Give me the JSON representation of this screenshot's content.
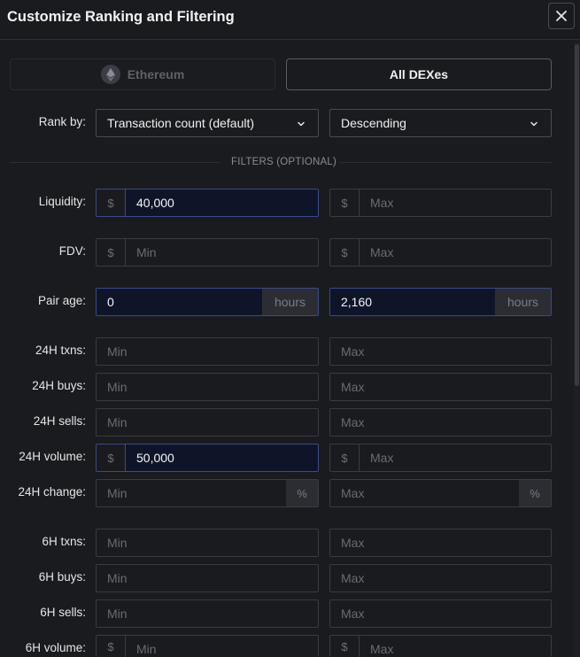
{
  "dialog": {
    "title": "Customize Ranking and Filtering"
  },
  "chain": {
    "label": "Ethereum"
  },
  "dex": {
    "label": "All DEXes"
  },
  "rank": {
    "label": "Rank by:",
    "sort_by": "Transaction count (default)",
    "order": "Descending"
  },
  "filters_heading": "FILTERS (OPTIONAL)",
  "units": {
    "dollar": "$",
    "hours": "hours",
    "percent": "%"
  },
  "filters": {
    "liquidity": {
      "label": "Liquidity:",
      "min": "40,000",
      "max_placeholder": "Max"
    },
    "fdv": {
      "label": "FDV:",
      "min_placeholder": "Min",
      "max_placeholder": "Max"
    },
    "pair_age": {
      "label": "Pair age:",
      "min": "0",
      "max": "2,160"
    },
    "txns_24h": {
      "label": "24H txns:",
      "min_placeholder": "Min",
      "max_placeholder": "Max"
    },
    "buys_24h": {
      "label": "24H buys:",
      "min_placeholder": "Min",
      "max_placeholder": "Max"
    },
    "sells_24h": {
      "label": "24H sells:",
      "min_placeholder": "Min",
      "max_placeholder": "Max"
    },
    "volume_24h": {
      "label": "24H volume:",
      "min": "50,000",
      "max_placeholder": "Max"
    },
    "change_24h": {
      "label": "24H change:",
      "min_placeholder": "Min",
      "max_placeholder": "Max"
    },
    "txns_6h": {
      "label": "6H txns:",
      "min_placeholder": "Min",
      "max_placeholder": "Max"
    },
    "buys_6h": {
      "label": "6H buys:",
      "min_placeholder": "Min",
      "max_placeholder": "Max"
    },
    "sells_6h": {
      "label": "6H sells:",
      "min_placeholder": "Min",
      "max_placeholder": "Max"
    },
    "volume_6h": {
      "label": "6H volume:",
      "min_placeholder": "Min",
      "max_placeholder": "Max"
    }
  },
  "icons": [
    "close-icon",
    "ethereum-icon",
    "chevron-down-icon"
  ]
}
